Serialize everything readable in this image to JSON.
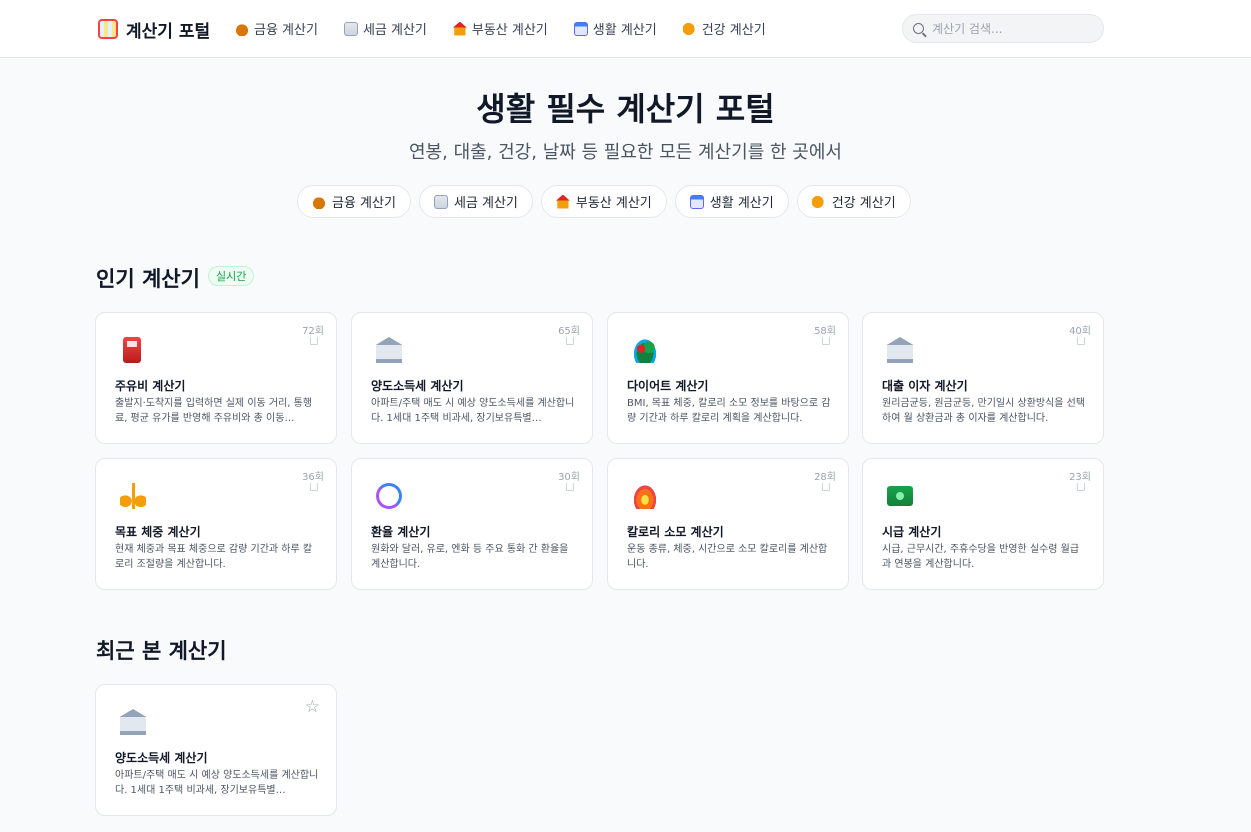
{
  "header": {
    "logo_text": "계산기 포털",
    "nav": [
      {
        "label": "금융 계산기",
        "icon": "money-bag-icon"
      },
      {
        "label": "세금 계산기",
        "icon": "receipt-icon"
      },
      {
        "label": "부동산 계산기",
        "icon": "house-icon"
      },
      {
        "label": "생활 계산기",
        "icon": "calendar-icon"
      },
      {
        "label": "건강 계산기",
        "icon": "flexed-arm-icon"
      }
    ],
    "search_placeholder": "계산기 검색..."
  },
  "hero": {
    "title": "생활 필수 계산기 포털",
    "subtitle": "연봉, 대출, 건강, 날짜 등 필요한 모든 계산기를 한 곳에서",
    "chips": [
      {
        "label": "금융 계산기",
        "icon": "money-bag-icon"
      },
      {
        "label": "세금 계산기",
        "icon": "receipt-icon"
      },
      {
        "label": "부동산 계산기",
        "icon": "house-icon"
      },
      {
        "label": "생활 계산기",
        "icon": "calendar-icon"
      },
      {
        "label": "건강 계산기",
        "icon": "flexed-arm-icon"
      }
    ]
  },
  "popular": {
    "title": "인기 계산기",
    "badge": "실시간",
    "cards": [
      {
        "count": "72회",
        "title": "주유비 계산기",
        "desc": "출발지·도착지를 입력하면 실제 이동 거리, 통행료, 평균 유가를 반영해 주유비와 총 이동…",
        "icon": "fuel-pump-icon"
      },
      {
        "count": "65회",
        "title": "양도소득세 계산기",
        "desc": "아파트/주택 매도 시 예상 양도소득세를 계산합니다. 1세대 1주택 비과세, 장기보유특별…",
        "icon": "bank-icon"
      },
      {
        "count": "58회",
        "title": "다이어트 계산기",
        "desc": "BMI, 목표 체중, 칼로리 소모 정보를 바탕으로 감량 기간과 하루 칼로리 계획을 계산합니다.",
        "icon": "salad-icon"
      },
      {
        "count": "40회",
        "title": "대출 이자 계산기",
        "desc": "원리금균등, 원금균등, 만기일시 상환방식을 선택하여 월 상환금과 총 이자를 계산합니다.",
        "icon": "bank-icon"
      },
      {
        "count": "36회",
        "title": "목표 체중 계산기",
        "desc": "현재 체중과 목표 체중으로 감량 기간과 하루 칼로리 조절량을 계산합니다.",
        "icon": "scale-icon"
      },
      {
        "count": "30회",
        "title": "환율 계산기",
        "desc": "원화와 달러, 유로, 엔화 등 주요 통화 간 환율을 계산합니다.",
        "icon": "currency-exchange-icon"
      },
      {
        "count": "28회",
        "title": "칼로리 소모 계산기",
        "desc": "운동 종류, 체중, 시간으로 소모 칼로리를 계산합니다.",
        "icon": "fire-icon"
      },
      {
        "count": "23회",
        "title": "시급 계산기",
        "desc": "시급, 근무시간, 주휴수당을 반영한 실수령 월급과 연봉을 계산합니다.",
        "icon": "cash-icon"
      }
    ]
  },
  "recent": {
    "title": "최근 본 계산기",
    "cards": [
      {
        "title": "양도소득세 계산기",
        "desc": "아파트/주택 매도 시 예상 양도소득세를 계산합니다. 1세대 1주택 비과세, 장기보유특별…",
        "icon": "bank-icon"
      }
    ]
  }
}
